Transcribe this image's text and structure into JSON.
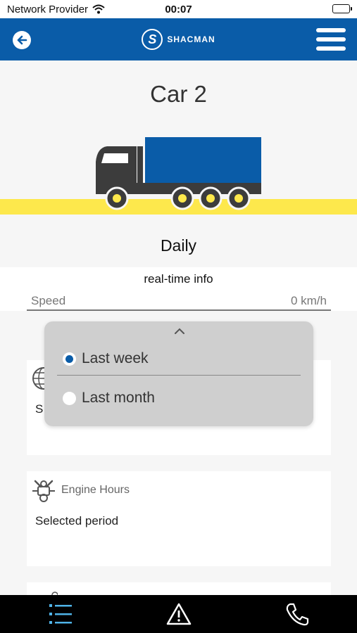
{
  "status_bar": {
    "carrier": "Network Provider",
    "time": "00:07"
  },
  "header": {
    "brand": "SHACMAN",
    "back_icon": "arrow-left-icon",
    "menu_icon": "hamburger-icon"
  },
  "vehicle": {
    "title": "Car 2",
    "accent": "#0a5ca8",
    "road_color": "#fde84c"
  },
  "period": {
    "selected_label": "Daily"
  },
  "realtime": {
    "title": "real-time info",
    "speed_label": "Speed",
    "speed_value": "0 km/h"
  },
  "dropdown": {
    "options": [
      {
        "label": "Last week",
        "selected": true
      },
      {
        "label": "Last month",
        "selected": false
      }
    ]
  },
  "cards": [
    {
      "title": "",
      "icon": "globe-icon",
      "partial_text": "S"
    },
    {
      "title": "Engine Hours",
      "icon": "engine-icon",
      "value": "Selected period"
    },
    {
      "title": "",
      "icon": "location-pin-icon"
    }
  ],
  "bottom_nav": [
    {
      "icon": "list-icon"
    },
    {
      "icon": "warning-icon"
    },
    {
      "icon": "phone-icon"
    }
  ]
}
